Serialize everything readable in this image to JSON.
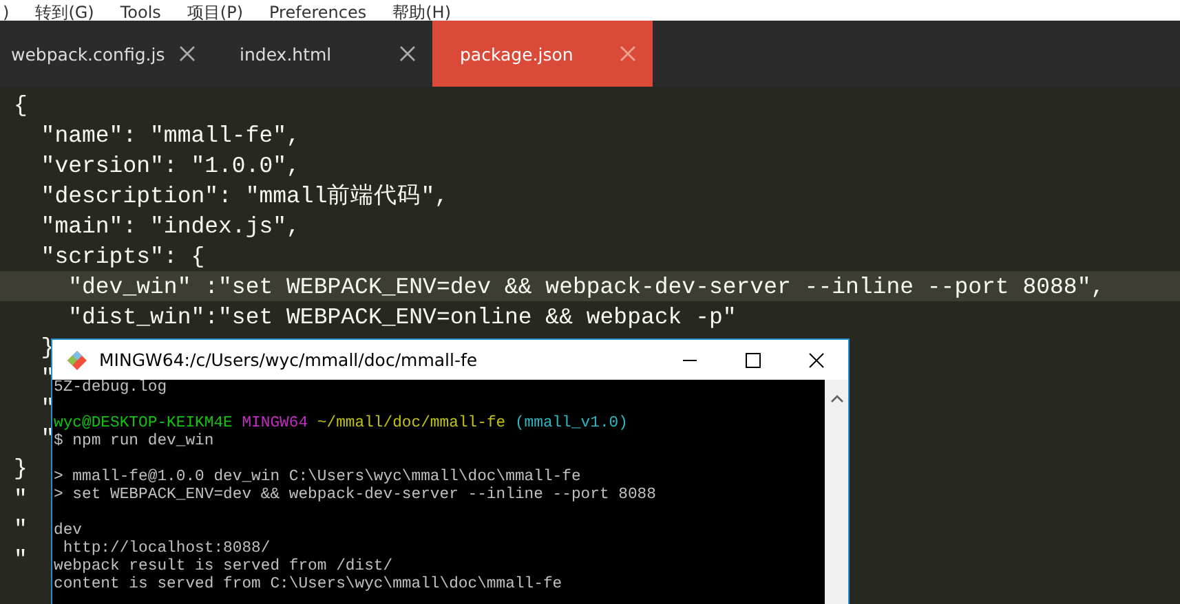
{
  "menu": [
    ")",
    "转到(G)",
    "Tools",
    "项目(P)",
    "Preferences",
    "帮助(H)"
  ],
  "tabs": [
    {
      "label": "webpack.config.js",
      "selected": false
    },
    {
      "label": "index.html",
      "selected": false
    },
    {
      "label": "package.json",
      "selected": true
    }
  ],
  "editor_lines": [
    {
      "text": "{",
      "current": false
    },
    {
      "text": "  \"name\": \"mmall-fe\",",
      "current": false
    },
    {
      "text": "  \"version\": \"1.0.0\",",
      "current": false
    },
    {
      "text": "  \"description\": \"mmall前端代码\",",
      "current": false
    },
    {
      "text": "  \"main\": \"index.js\",",
      "current": false
    },
    {
      "text": "  \"scripts\": {",
      "current": false
    },
    {
      "text": "    \"dev_win\" :\"set WEBPACK_ENV=dev && webpack-dev-server --inline --port 8088\",",
      "current": true
    },
    {
      "text": "    \"dist_win\":\"set WEBPACK_ENV=online && webpack -p\"",
      "current": false
    },
    {
      "text": "  }",
      "current": false
    },
    {
      "text": "  \"",
      "current": false
    },
    {
      "text": "  \"",
      "current": false
    },
    {
      "text": "  \"",
      "current": false
    },
    {
      "text": "}",
      "current": false
    },
    {
      "text": "\"",
      "current": false
    },
    {
      "text": "\"",
      "current": false
    },
    {
      "text": "\"",
      "current": false
    }
  ],
  "terminal": {
    "title": "MINGW64:/c/Users/wyc/mmall/doc/mmall-fe",
    "lines": [
      {
        "gap_before": false,
        "segments": [
          {
            "text": "5Z-debug.log",
            "color": "#c0c0c0"
          }
        ]
      },
      {
        "gap_before": true,
        "segments": [
          {
            "text": "wyc@DESKTOP-KEIKM4E ",
            "color": "#13c313"
          },
          {
            "text": "MINGW64 ",
            "color": "#c22cc2"
          },
          {
            "text": "~/mmall/doc/mmall-fe ",
            "color": "#c2c213"
          },
          {
            "text": "(mmall_v1.0)",
            "color": "#2ab8c2"
          }
        ]
      },
      {
        "gap_before": false,
        "segments": [
          {
            "text": "$ npm run dev_win",
            "color": "#c0c0c0"
          }
        ]
      },
      {
        "gap_before": true,
        "segments": [
          {
            "text": "> mmall-fe@1.0.0 dev_win C:\\Users\\wyc\\mmall\\doc\\mmall-fe",
            "color": "#c0c0c0"
          }
        ]
      },
      {
        "gap_before": false,
        "segments": [
          {
            "text": "> set WEBPACK_ENV=dev && webpack-dev-server --inline --port 8088",
            "color": "#c0c0c0"
          }
        ]
      },
      {
        "gap_before": true,
        "segments": [
          {
            "text": "dev",
            "color": "#c0c0c0"
          }
        ]
      },
      {
        "gap_before": false,
        "segments": [
          {
            "text": " http://localhost:8088/",
            "color": "#c0c0c0"
          }
        ]
      },
      {
        "gap_before": false,
        "segments": [
          {
            "text": "webpack result is served from /dist/",
            "color": "#c0c0c0"
          }
        ]
      },
      {
        "gap_before": false,
        "segments": [
          {
            "text": "content is served from C:\\Users\\wyc\\mmall\\doc\\mmall-fe",
            "color": "#c0c0c0"
          }
        ]
      }
    ]
  }
}
